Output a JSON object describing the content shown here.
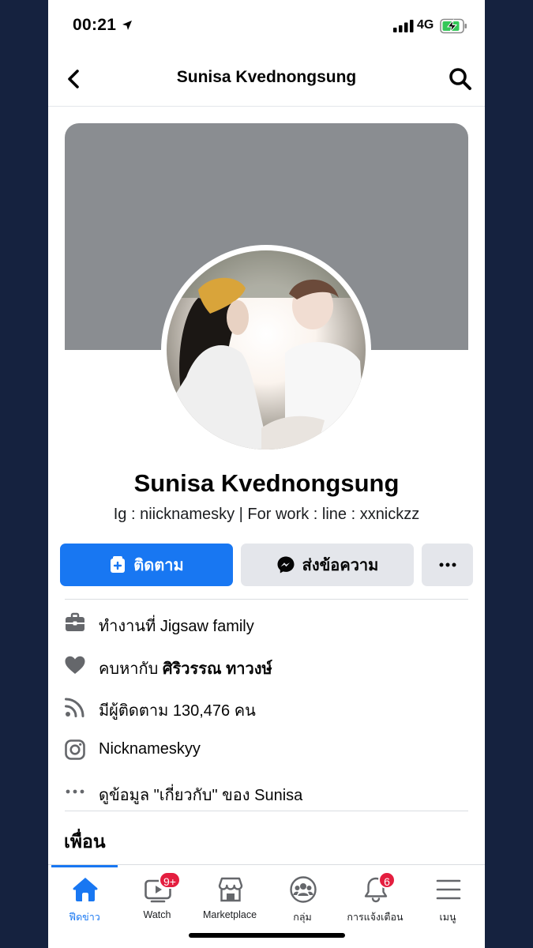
{
  "status_bar": {
    "time": "00:21",
    "network": "4G"
  },
  "nav": {
    "title": "Sunisa Kvednongsung"
  },
  "profile": {
    "name": "Sunisa Kvednongsung",
    "bio": "Ig : niicknamesky | For work : line : xxnickzz"
  },
  "actions": {
    "follow_label": "ติดตาม",
    "message_label": "ส่งข้อความ",
    "more_label": "···"
  },
  "info": {
    "work_prefix": "ทำงานที่",
    "work_place": "Jigsaw family",
    "relationship_prefix": "คบหากับ",
    "relationship_partner": "ศิริวรรณ ทาวงษ์",
    "followers_prefix": "มีผู้ติดตาม",
    "followers_count": "130,476",
    "followers_suffix": "คน",
    "instagram": "Nicknameskyy",
    "about_link": "ดูข้อมูล \"เกี่ยวกับ\" ของ Sunisa"
  },
  "friends": {
    "title": "เพื่อน"
  },
  "tabs": [
    {
      "label": "ฟีดข่าว",
      "icon": "home-icon",
      "active": true
    },
    {
      "label": "Watch",
      "icon": "watch-icon",
      "badge": "9+"
    },
    {
      "label": "Marketplace",
      "icon": "marketplace-icon"
    },
    {
      "label": "กลุ่ม",
      "icon": "groups-icon"
    },
    {
      "label": "การแจ้งเตือน",
      "icon": "bell-icon",
      "badge": "6"
    },
    {
      "label": "เมนู",
      "icon": "menu-icon"
    }
  ],
  "colors": {
    "primary": "#1877f2",
    "cover": "#8a8d91",
    "badge": "#e41e3f",
    "backdrop": "#15223f"
  }
}
